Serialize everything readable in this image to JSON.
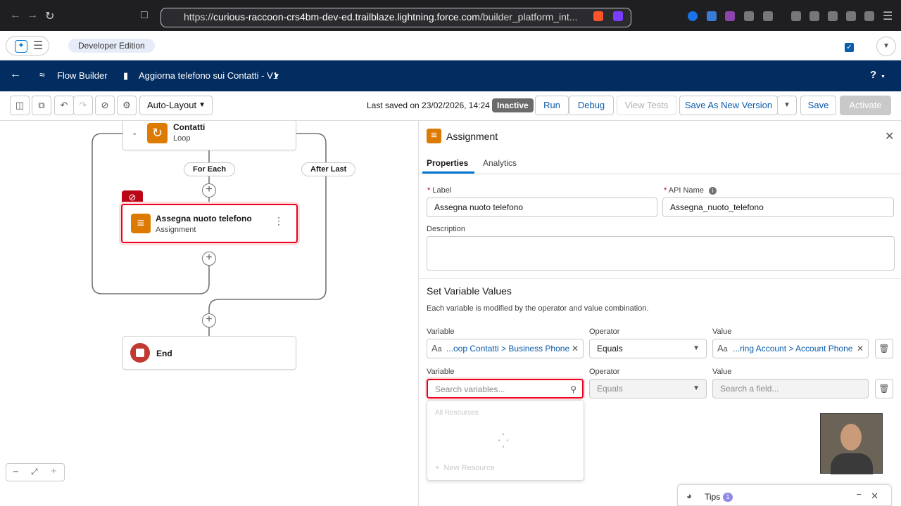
{
  "browser": {
    "url_scheme": "https://",
    "url_host": "curious-raccoon-crs4bm-dev-ed.trailblaze.lightning.force.com",
    "url_path": "/builder_platform_int..."
  },
  "sf_header": {
    "edition_badge": "Developer Edition"
  },
  "flow_bar": {
    "app_name": "Flow Builder",
    "flow_name": "Aggiorna telefono sui Contatti - V1",
    "help": "?"
  },
  "toolbar": {
    "layout_select": "Auto-Layout",
    "last_saved": "Last saved on 23/02/2026, 14:24",
    "status_badge": "Inactive",
    "run": "Run",
    "debug": "Debug",
    "view_tests": "View Tests",
    "save_new_version": "Save As New Version",
    "save": "Save",
    "activate": "Activate"
  },
  "canvas": {
    "loop_node": {
      "title": "Contatti",
      "subtitle": "Loop"
    },
    "for_each": "For Each",
    "after_last": "After Last",
    "assignment_node": {
      "title": "Assegna nuoto telefono",
      "subtitle": "Assignment"
    },
    "end_node": {
      "title": "End"
    }
  },
  "panel": {
    "title": "Assignment",
    "tabs": [
      "Properties",
      "Analytics"
    ],
    "label_label": "Label",
    "label_value": "Assegna nuoto telefono",
    "api_label": "API Name",
    "api_value": "Assegna_nuoto_telefono",
    "description_label": "Description",
    "section_title": "Set Variable Values",
    "section_help": "Each variable is modified by the operator and value combination.",
    "rows": [
      {
        "variable_label": "Variable",
        "variable": "...oop Contatti > Business Phone",
        "operator_label": "Operator",
        "operator": "Equals",
        "value_label": "Value",
        "value": "...ring Account > Account Phone"
      },
      {
        "variable_label": "Variable",
        "variable_placeholder": "Search variables...",
        "operator_label": "Operator",
        "operator": "Equals",
        "value_label": "Value",
        "value_placeholder": "Search a field..."
      }
    ],
    "dropdown": {
      "header": "All Resources",
      "new_resource": "New Resource"
    }
  },
  "tips": {
    "label": "Tips",
    "count": "1"
  },
  "colors": {
    "nav_bar": "#032d60",
    "brand_blue": "#0b5cab",
    "assignment_orange": "#dd7a01",
    "end_red": "#c23934",
    "error_red": "#ba0517"
  }
}
